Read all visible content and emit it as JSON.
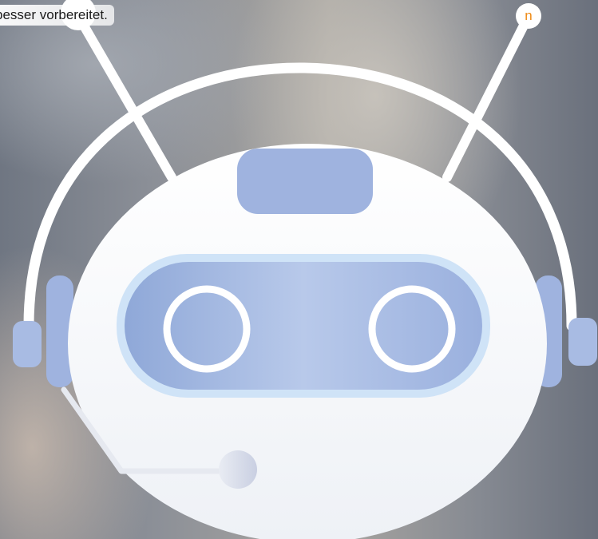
{
  "caption": {
    "text": "besser vorbereitet."
  },
  "badge": {
    "letter": "n",
    "color": "#ee8a16"
  },
  "robot": {
    "icon": "chatbot-robot-icon",
    "colors": {
      "face": "#ffffff",
      "visor": "#a9bfe6",
      "visor_rim": "#cfe3f7",
      "accent": "#9fb3df",
      "stroke": "#ffffff"
    }
  }
}
